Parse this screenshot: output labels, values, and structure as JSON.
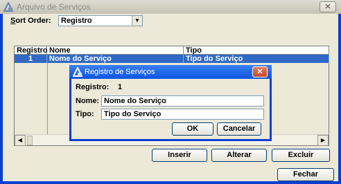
{
  "window": {
    "title": "Arquivo de Serviços",
    "close_label": "✕"
  },
  "sort": {
    "label_underlined": "S",
    "label_rest": "ort Order:",
    "value": "Registro"
  },
  "grid": {
    "headers": [
      "Registro",
      "Nome",
      "Tipo"
    ],
    "rows": [
      {
        "registro": "1",
        "nome": "Nome do Serviço",
        "tipo": "Tipo do Serviço"
      }
    ]
  },
  "buttons": {
    "inserir": "Inserir",
    "alterar": "Alterar",
    "excluir": "Excluir",
    "fechar": "Fechar"
  },
  "dialog": {
    "title": "Registro de Serviços",
    "close_label": "✕",
    "registro_label": "Registro:",
    "registro_value": "1",
    "nome_label": "Nome:",
    "nome_value": "Nome do Serviço",
    "tipo_label": "Tipo:",
    "tipo_value": "Tipo do Serviço",
    "ok": "OK",
    "cancel": "Cancelar"
  },
  "colors": {
    "selection": "#316ac5",
    "dialog_title": "#0c54e0",
    "window_face": "#ece9d8"
  },
  "icons": [
    "app-icon",
    "close-icon",
    "dropdown-arrow-icon",
    "scroll-left-icon",
    "scroll-right-icon"
  ]
}
